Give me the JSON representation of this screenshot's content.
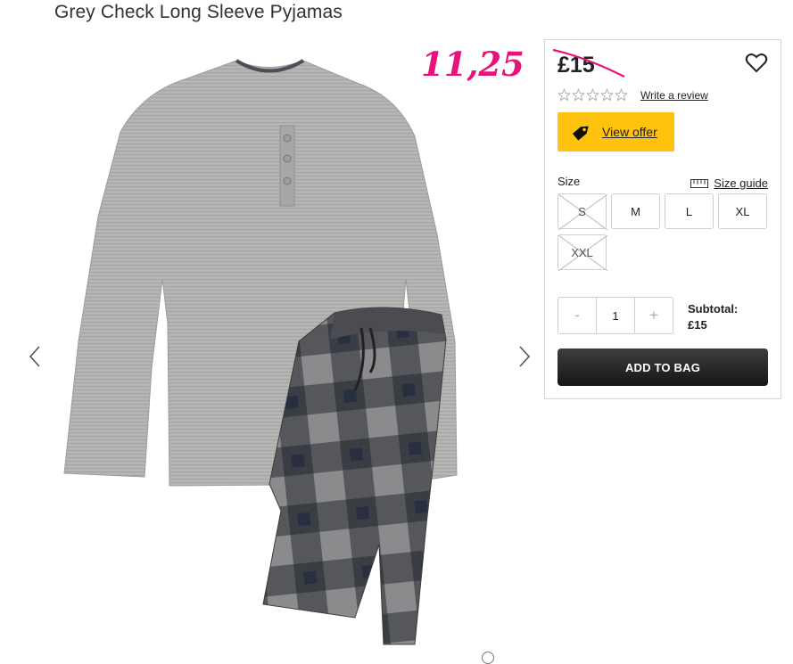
{
  "product": {
    "title": "Grey Check Long Sleeve Pyjamas"
  },
  "annotation": {
    "handwritten_price": "11,25",
    "color": "#e8127a"
  },
  "panel": {
    "price": "£15",
    "write_review": "Write a review",
    "rating": {
      "stars_filled": 0,
      "stars_total": 5
    },
    "offer_label": "View offer",
    "size_label": "Size",
    "size_guide": "Size guide",
    "sizes": [
      {
        "label": "S",
        "available": false
      },
      {
        "label": "M",
        "available": true
      },
      {
        "label": "L",
        "available": true
      },
      {
        "label": "XL",
        "available": true
      },
      {
        "label": "XXL",
        "available": false
      }
    ],
    "quantity": {
      "minus": "-",
      "value": "1",
      "plus": "+"
    },
    "subtotal_label": "Subtotal:",
    "subtotal_value": "£15",
    "add_to_bag": "ADD TO BAG"
  },
  "colors": {
    "offer_bg": "#ffc20e",
    "button_dark": "#222222",
    "strike_pink": "#e8127a"
  },
  "icons": [
    "chevron-left-icon",
    "chevron-right-icon",
    "heart-icon",
    "star-icon",
    "tag-icon",
    "ruler-icon"
  ]
}
